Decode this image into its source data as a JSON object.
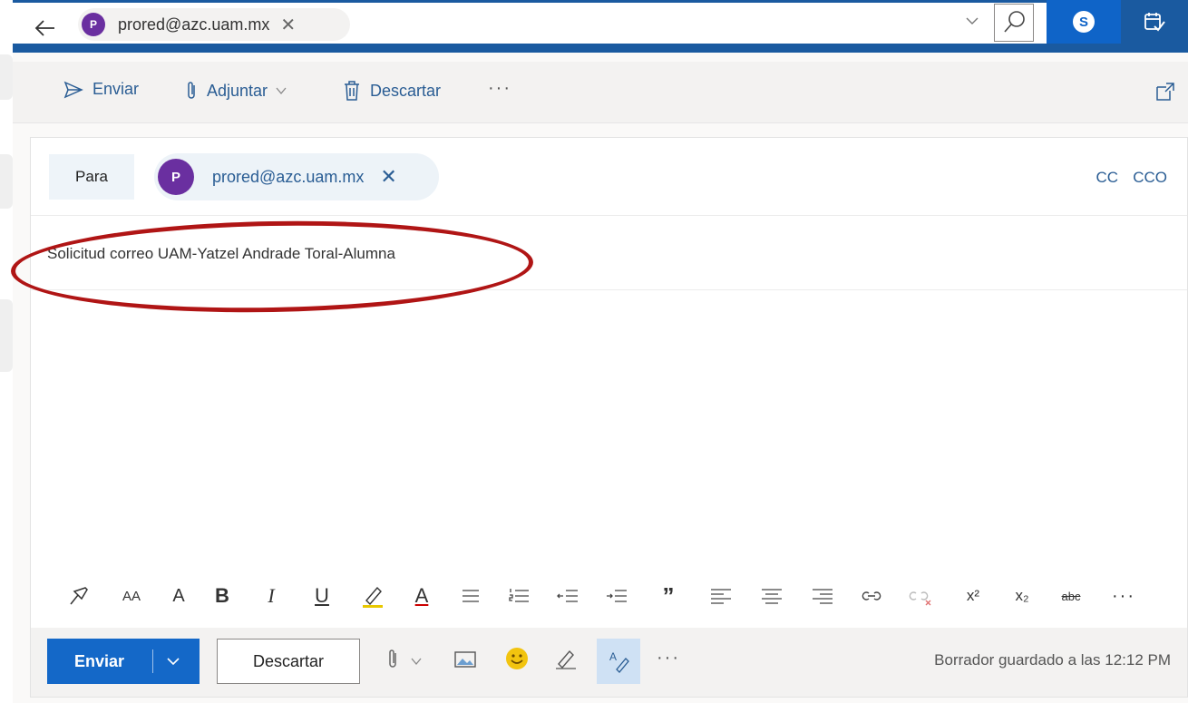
{
  "topbar": {
    "recipient_initial": "P",
    "recipient_email": "prored@azc.uam.mx",
    "close_glyph": "✕",
    "skype_letter": "S",
    "icons": [
      "back-arrow-icon",
      "chevron-down-icon",
      "search-icon",
      "skype-icon",
      "calendar-check-icon"
    ]
  },
  "commandbar": {
    "send": "Enviar",
    "attach": "Adjuntar",
    "discard": "Descartar",
    "more": "···"
  },
  "compose": {
    "to_label": "Para",
    "to_chip": {
      "initial": "P",
      "email": "prored@azc.uam.mx",
      "close": "✕"
    },
    "cc": "CC",
    "cco": "CCO",
    "subject": "Solicitud correo UAM-Yatzel Andrade Toral-Alumna"
  },
  "format_toolbar": {
    "font_size_label": "AA",
    "grow_font_label": "A",
    "bold": "B",
    "italic": "I",
    "underline": "U",
    "font_color": "A",
    "quote": "”",
    "superscript": "x²",
    "subscript": "x₂",
    "strikethrough": "abc",
    "more": "···"
  },
  "bottombar": {
    "send": "Enviar",
    "discard": "Descartar",
    "more": "···",
    "saved_status": "Borrador guardado a las 12:12 PM"
  },
  "colors": {
    "accent_blue": "#1a5aa0",
    "send_blue": "#1468c8",
    "link_blue": "#2a5d94",
    "avatar_purple": "#6a2fa0",
    "annotation_red": "#b01515"
  }
}
